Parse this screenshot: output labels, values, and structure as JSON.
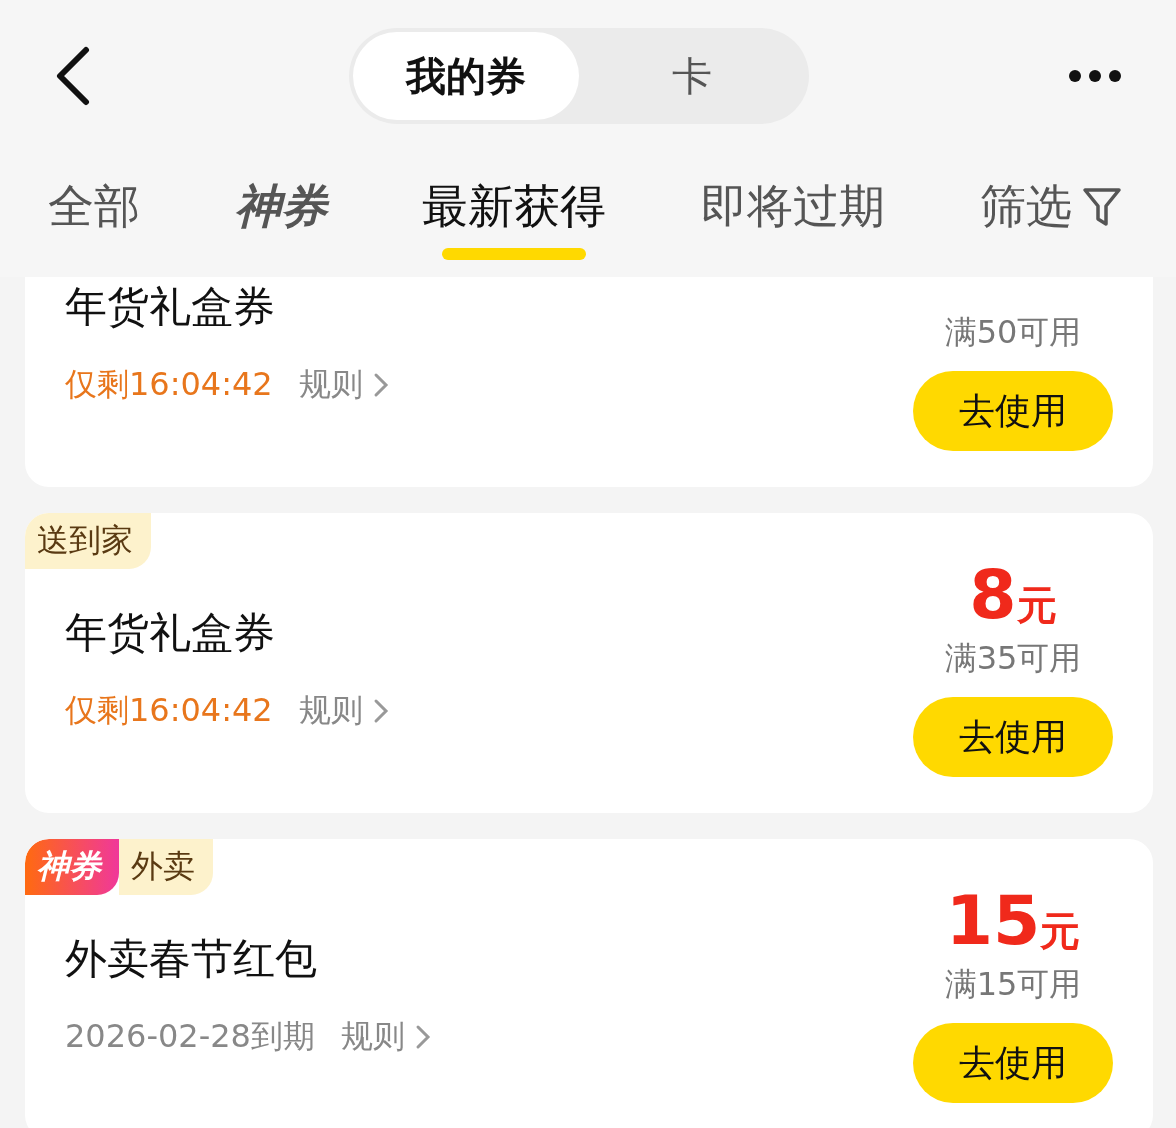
{
  "segments": [
    {
      "label": "我的券",
      "selected": true
    },
    {
      "label": "卡",
      "selected": false
    }
  ],
  "tabs": [
    {
      "label": "全部",
      "kind": "plain",
      "selected": false
    },
    {
      "label": "神券",
      "kind": "brand",
      "selected": false
    },
    {
      "label": "最新获得",
      "kind": "plain",
      "selected": true
    },
    {
      "label": "即将过期",
      "kind": "plain",
      "selected": false
    }
  ],
  "filter": {
    "label": "筛选"
  },
  "coupons": [
    {
      "title": "年货礼盒券",
      "expiry": "仅剩16:04:42",
      "urgent": true,
      "rules": "规则",
      "condition": "满50可用",
      "button": "去使用"
    },
    {
      "tags": [
        {
          "label": "送到家",
          "kind": "category"
        }
      ],
      "title": "年货礼盒券",
      "expiry": "仅剩16:04:42",
      "urgent": true,
      "rules": "规则",
      "amount": "8",
      "unit": "元",
      "condition": "满35可用",
      "button": "去使用"
    },
    {
      "tags": [
        {
          "label": "神券",
          "kind": "brand"
        },
        {
          "label": "外卖",
          "kind": "category"
        }
      ],
      "title": "外卖春节红包",
      "expiry": "2026-02-28到期",
      "urgent": false,
      "rules": "规则",
      "amount": "15",
      "unit": "元",
      "condition": "满15可用",
      "button": "去使用"
    }
  ]
}
